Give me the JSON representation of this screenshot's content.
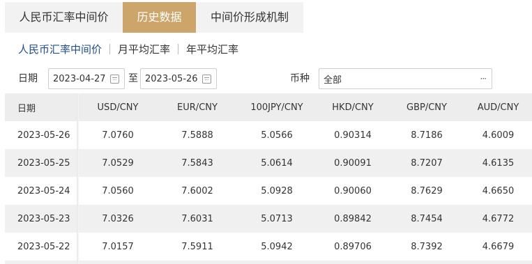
{
  "tabs": [
    {
      "label": "人民币汇率中间价",
      "active": false
    },
    {
      "label": "历史数据",
      "active": true
    },
    {
      "label": "中间价形成机制",
      "active": false
    }
  ],
  "subnav": [
    {
      "label": "人民币汇率中间价",
      "active": true
    },
    {
      "label": "月平均汇率",
      "active": false
    },
    {
      "label": "年平均汇率",
      "active": false
    }
  ],
  "filter": {
    "date_label": "日期",
    "start_date": "2023-04-27",
    "to_label": "至",
    "end_date": "2023-05-26",
    "currency_label": "币种",
    "currency_value": "全部",
    "more_icon": "···"
  },
  "table": {
    "headers": [
      "日期",
      "USD/CNY",
      "EUR/CNY",
      "100JPY/CNY",
      "HKD/CNY",
      "GBP/CNY",
      "AUD/CNY"
    ],
    "rows": [
      [
        "2023-05-26",
        "7.0760",
        "7.5888",
        "5.0566",
        "0.90314",
        "8.7186",
        "4.6009"
      ],
      [
        "2023-05-25",
        "7.0529",
        "7.5843",
        "5.0614",
        "0.90091",
        "8.7207",
        "4.6135"
      ],
      [
        "2023-05-24",
        "7.0560",
        "7.6002",
        "5.0928",
        "0.90060",
        "8.7629",
        "4.6650"
      ],
      [
        "2023-05-23",
        "7.0326",
        "7.6031",
        "5.0713",
        "0.89842",
        "8.7454",
        "4.6772"
      ],
      [
        "2023-05-22",
        "7.0157",
        "7.5911",
        "5.0942",
        "0.89706",
        "8.7392",
        "4.6679"
      ]
    ]
  },
  "colors": {
    "active_tab_bg": "#cba56a",
    "active_subnav": "#1f4e8a"
  }
}
